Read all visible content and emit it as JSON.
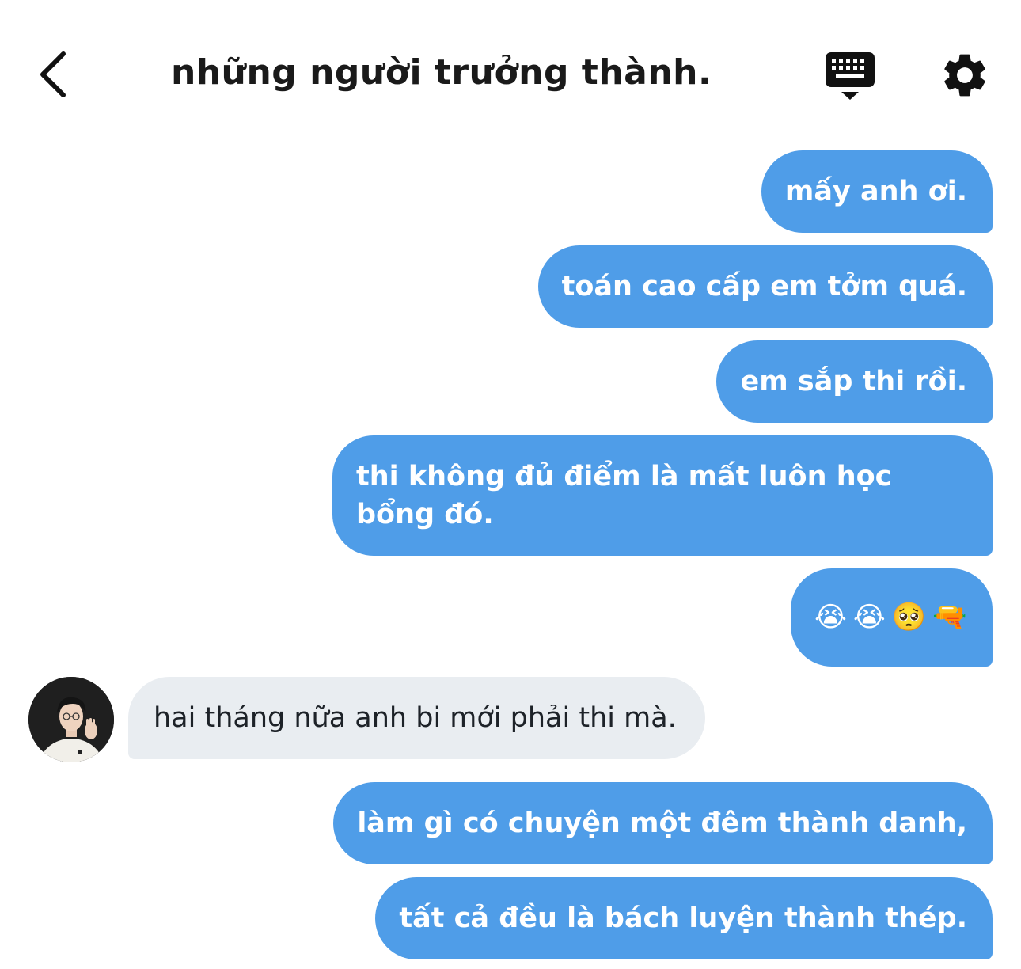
{
  "header": {
    "title": "những người trưởng thành.",
    "back_icon": "chevron-left-icon",
    "keyboard_icon": "keyboard-hide-icon",
    "settings_icon": "gear-icon"
  },
  "messages": [
    {
      "direction": "out",
      "text": "mấy anh ơi."
    },
    {
      "direction": "out",
      "text": "toán cao cấp em tởm quá."
    },
    {
      "direction": "out",
      "text": "em sắp thi rồi."
    },
    {
      "direction": "out",
      "text": "thi không đủ điểm là mất luôn học bổng đó."
    },
    {
      "direction": "out",
      "emojis": [
        "😭",
        "😭",
        "🥺",
        "🔫"
      ]
    },
    {
      "direction": "in",
      "text": "hai tháng nữa anh bi mới phải thi mà."
    },
    {
      "direction": "out",
      "text": "làm gì có chuyện một đêm thành danh,"
    },
    {
      "direction": "out",
      "text": "tất cả đều là bách luyện thành thép."
    }
  ],
  "colors": {
    "outgoing_bubble": "#4f9de8",
    "incoming_bubble": "#e9edf1",
    "title_text": "#1a1a1a"
  }
}
